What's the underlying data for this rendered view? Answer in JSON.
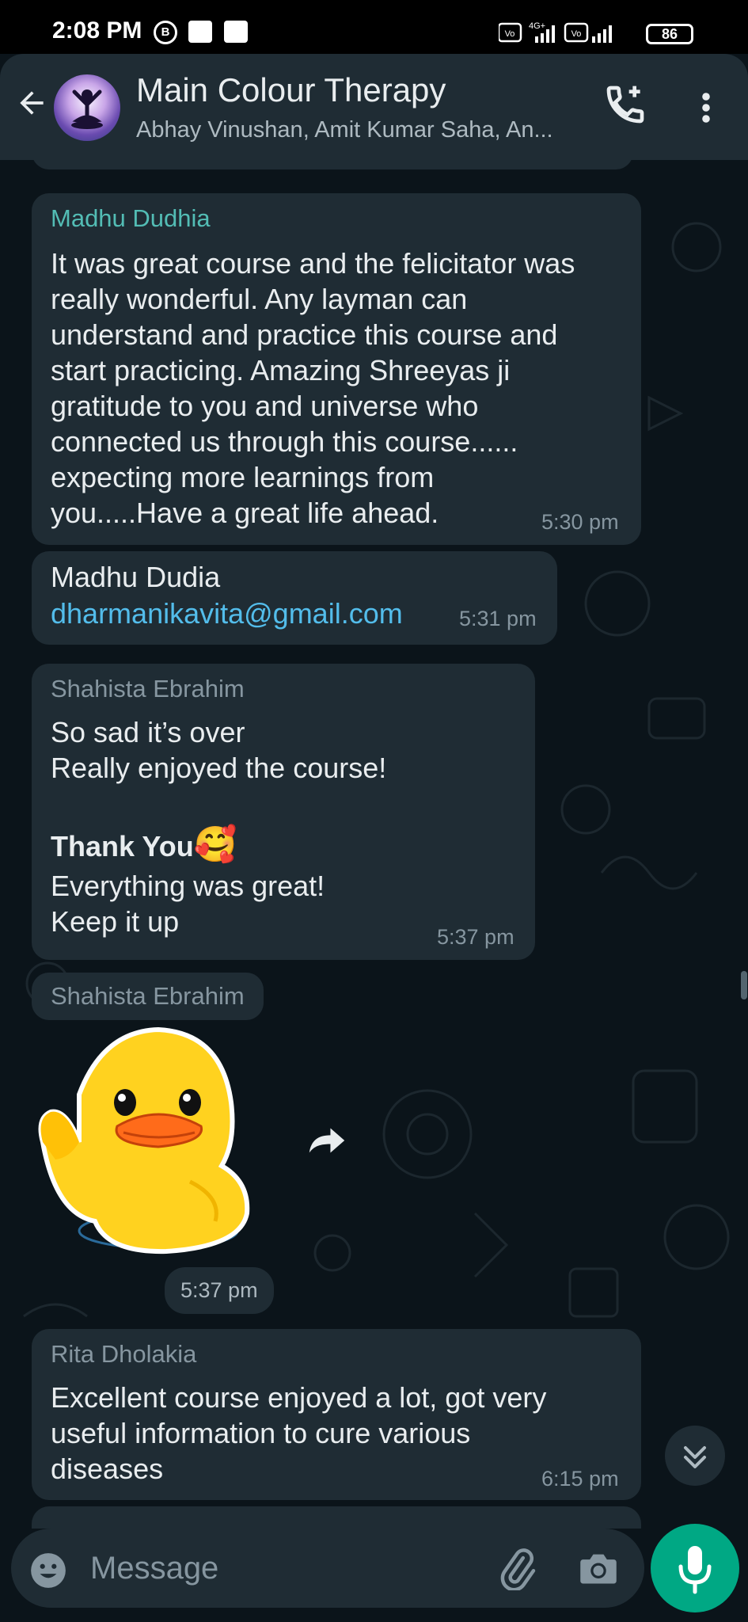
{
  "status_bar": {
    "time": "2:08 PM",
    "icons": [
      "b-icon",
      "paytm-icon",
      "notification-icon",
      "volte-icon",
      "signal-icon",
      "battery-icon"
    ],
    "network_label": "4G+",
    "battery": "86"
  },
  "header": {
    "title": "Main Colour Therapy",
    "subtitle": "Abhay Vinushan, Amit Kumar Saha, An..."
  },
  "messages": [
    {
      "sender": "Madhu Dudhia",
      "sender_color": "#53bdb5",
      "lines": [
        "It was great course and the felicitator was",
        "really wonderful. Any layman can",
        "understand and practice this course and",
        "start practicing. Amazing Shreeyas ji",
        "gratitude to you and universe who",
        "connected us through this course......",
        "expecting more learnings from",
        "you.....Have a great life ahead."
      ],
      "time": "5:30 pm"
    },
    {
      "line": "Madhu Dudia",
      "link": "dharmanikavita@gmail.com",
      "time": "5:31 pm"
    },
    {
      "sender": "Shahista Ebrahim",
      "sender_color": "#8696a0",
      "lines": [
        "So sad it’s over",
        "Really enjoyed the course!"
      ],
      "bold": "Thank You",
      "emoji": "🥰",
      "lines2": [
        "Everything was great!",
        "Keep it up"
      ],
      "time": "5:37 pm"
    },
    {
      "sender": "Shahista Ebrahim",
      "sticker": "duck-sticker",
      "time": "5:37 pm"
    },
    {
      "sender": "Rita Dholakia",
      "sender_color": "#8696a0",
      "lines": [
        "Excellent course enjoyed a lot, got very",
        "useful information to cure various",
        "diseases"
      ],
      "time": "6:15 pm"
    }
  ],
  "composer": {
    "placeholder": "Message"
  },
  "colors": {
    "background": "#0b141a",
    "bubble": "#1f2c34",
    "accent": "#00a884",
    "link": "#53bdeb"
  }
}
